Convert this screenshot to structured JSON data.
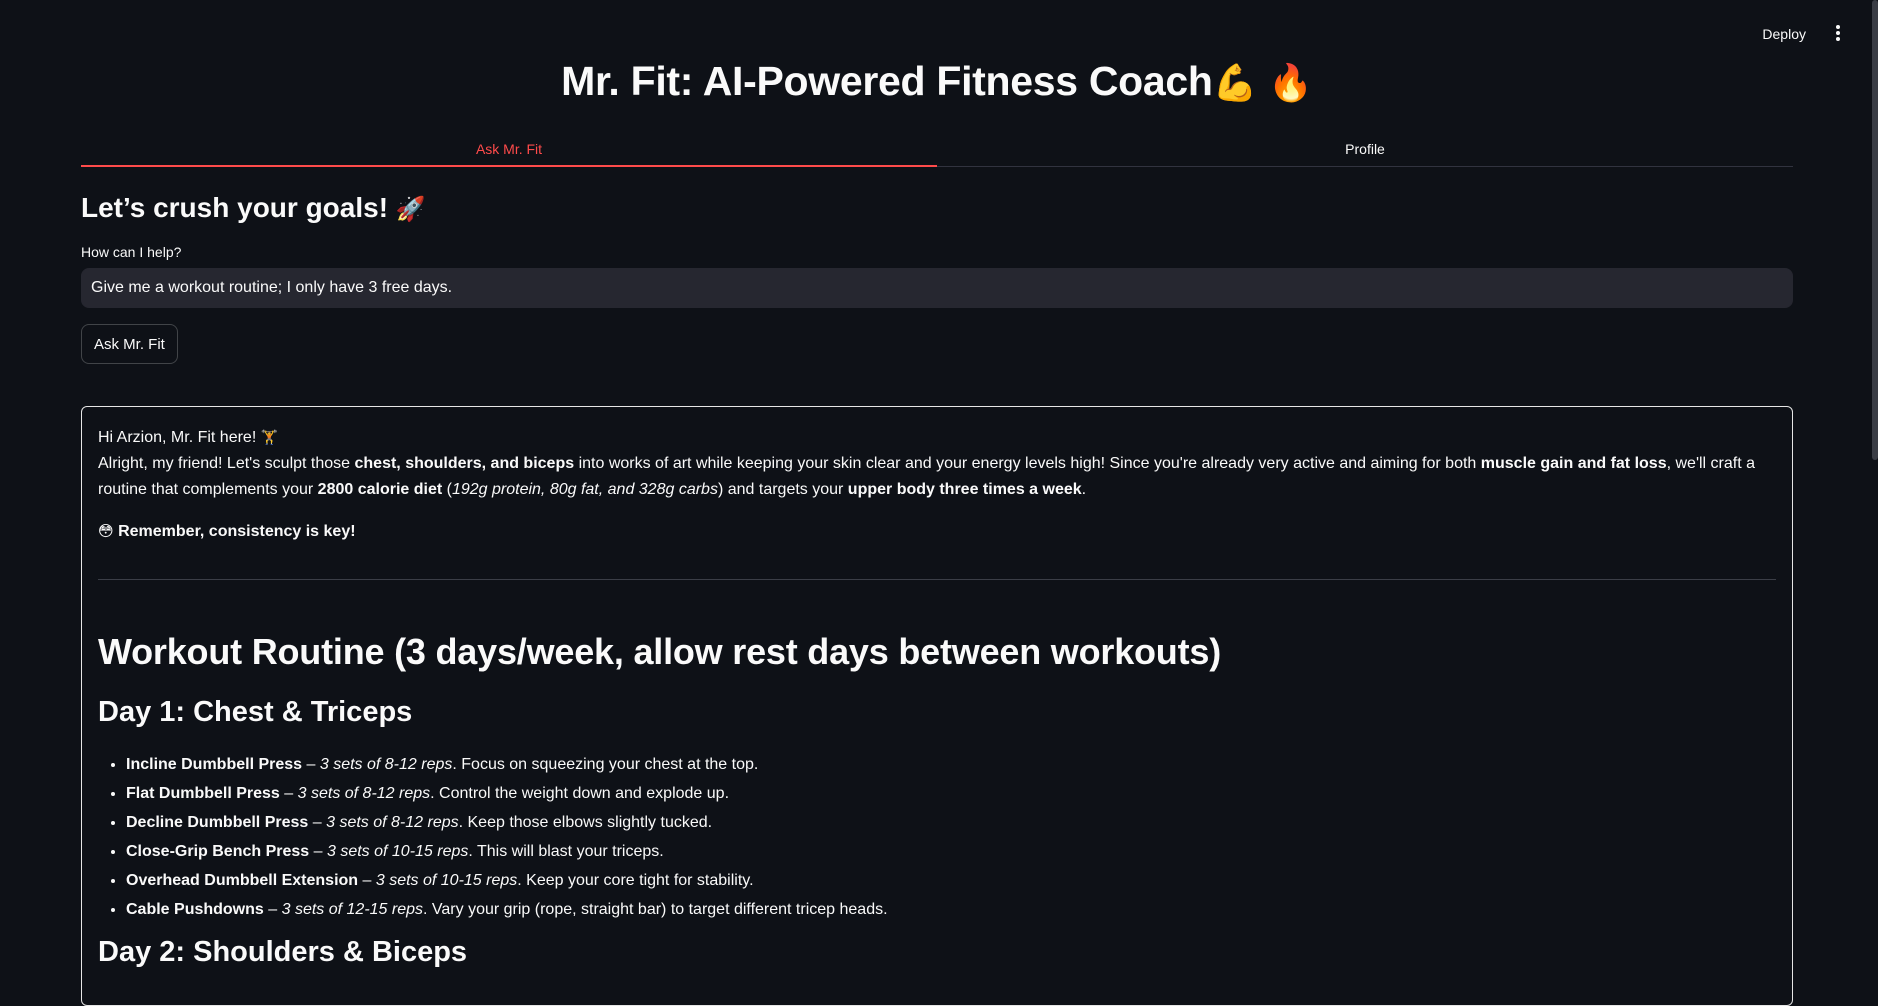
{
  "header": {
    "deploy_label": "Deploy",
    "menu_icon": "kebab-vertical-icon"
  },
  "title": {
    "text": "Mr. Fit: AI-Powered Fitness Coach",
    "emoji_1": "💪",
    "emoji_2": "🔥"
  },
  "tabs": [
    {
      "label": "Ask Mr. Fit",
      "active": true
    },
    {
      "label": "Profile",
      "active": false
    }
  ],
  "ask": {
    "heading": "Let’s crush your goals!",
    "heading_emoji": "🚀",
    "input_label": "How can I help?",
    "input_value": "Give me a workout routine; I only have 3 free days.",
    "button_label": "Ask Mr. Fit"
  },
  "response": {
    "greeting": "Hi Arzion, Mr. Fit here!",
    "greeting_emoji": "🏋",
    "intro": {
      "t1": "Alright, my friend! Let's sculpt those ",
      "b1": "chest, shoulders, and biceps",
      "t2": " into works of art while keeping your skin clear and your energy levels high! Since you're already very active and aiming for both ",
      "b2": "muscle gain and fat loss",
      "t3": ", we'll craft a routine that complements your ",
      "b3": "2800 calorie diet",
      "t4": " (",
      "i1": "192g protein, 80g fat, and 328g carbs",
      "t5": ") and targets your ",
      "b4": "upper body three times a week",
      "t6": "."
    },
    "reminder_emoji": "😳",
    "reminder": "Remember, consistency is key!",
    "routine_title": "Workout Routine (3 days/week, allow rest days between workouts)",
    "day1_title": "Day 1: Chest & Triceps",
    "day1_exercises": [
      {
        "name": "Incline Dumbbell Press",
        "sep": " – ",
        "sets": "3 sets of 8-12 reps",
        "note": ". Focus on squeezing your chest at the top."
      },
      {
        "name": "Flat Dumbbell Press",
        "sep": " – ",
        "sets": "3 sets of 8-12 reps",
        "note": ". Control the weight down and explode up."
      },
      {
        "name": "Decline Dumbbell Press",
        "sep": " – ",
        "sets": "3 sets of 8-12 reps",
        "note": ". Keep those elbows slightly tucked."
      },
      {
        "name": "Close-Grip Bench Press",
        "sep": " – ",
        "sets": "3 sets of 10-15 reps",
        "note": ". This will blast your triceps."
      },
      {
        "name": "Overhead Dumbbell Extension",
        "sep": " – ",
        "sets": "3 sets of 10-15 reps",
        "note": ". Keep your core tight for stability."
      },
      {
        "name": "Cable Pushdowns",
        "sep": " – ",
        "sets": "3 sets of 12-15 reps",
        "note": ". Vary your grip (rope, straight bar) to target different tricep heads."
      }
    ],
    "day2_title": "Day 2: Shoulders & Biceps"
  },
  "colors": {
    "background": "#0e1117",
    "text": "#fafafa",
    "accent": "#ff4b4b",
    "input_bg": "#262730"
  }
}
